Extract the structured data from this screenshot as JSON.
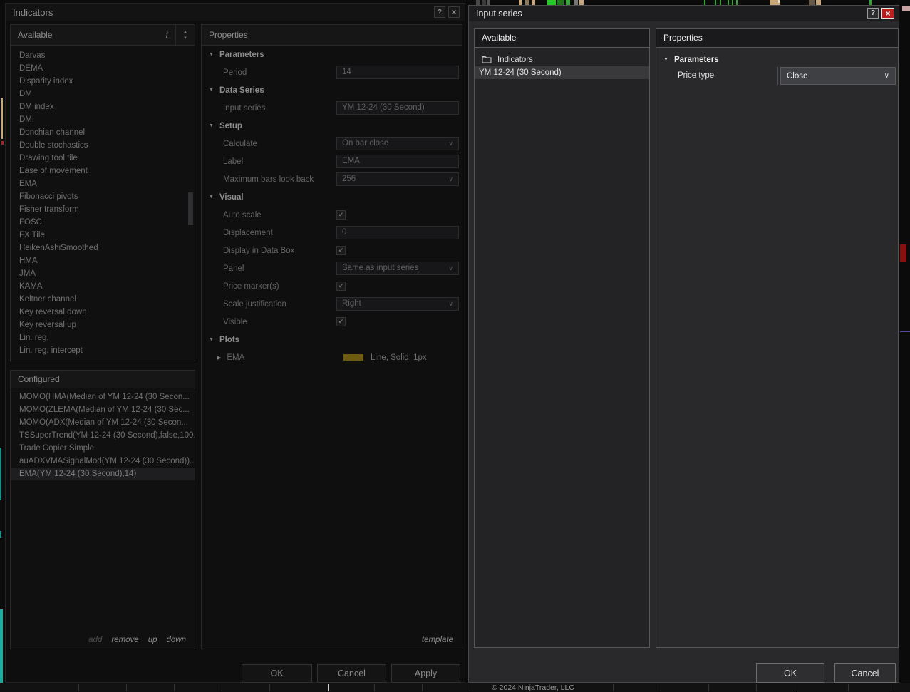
{
  "icons": {
    "help": "?",
    "close": "×",
    "info": "i",
    "check": "✔",
    "chevron_down": "∨",
    "collapse": "▼",
    "expand": "▶",
    "spinner_up": "▲",
    "spinner_down": "▼"
  },
  "colors": {
    "plot_swatch": "#6e5a12",
    "close_button_red": "#bf1b1b",
    "teal_accent": "#17b0a0",
    "selected_row": "#39393c"
  },
  "left_dialog": {
    "title": "Indicators",
    "available": {
      "header": "Available",
      "items": [
        "Darvas",
        "DEMA",
        "Disparity index",
        "DM",
        "DM index",
        "DMI",
        "Donchian channel",
        "Double stochastics",
        "Drawing tool tile",
        "Ease of movement",
        "EMA",
        "Fibonacci pivots",
        "Fisher transform",
        "FOSC",
        "FX Tile",
        "HeikenAshiSmoothed",
        "HMA",
        "JMA",
        "KAMA",
        "Keltner channel",
        "Key reversal down",
        "Key reversal up",
        "Lin. reg.",
        "Lin. reg. intercept"
      ]
    },
    "configured": {
      "header": "Configured",
      "items": [
        "MOMO(HMA(Median of YM 12-24 (30 Secon...",
        "MOMO(ZLEMA(Median of YM 12-24 (30 Sec...",
        "MOMO(ADX(Median of YM 12-24 (30 Secon...",
        "TSSuperTrend(YM 12-24 (30 Second),false,100...",
        "Trade Copier Simple",
        "auADXVMASignalMod(YM 12-24 (30 Second))...",
        "EMA(YM 12-24 (30 Second),14)"
      ],
      "selected_index": 6
    },
    "list_actions": {
      "add": "add",
      "remove": "remove",
      "up": "up",
      "down": "down"
    },
    "properties": {
      "header": "Properties",
      "template_link": "template",
      "groups": [
        {
          "label": "Parameters",
          "rows": [
            {
              "label": "Period",
              "type": "input",
              "value": "14"
            }
          ]
        },
        {
          "label": "Data Series",
          "rows": [
            {
              "label": "Input series",
              "type": "input",
              "value": "YM 12-24 (30 Second)"
            }
          ]
        },
        {
          "label": "Setup",
          "rows": [
            {
              "label": "Calculate",
              "type": "select",
              "value": "On bar close"
            },
            {
              "label": "Label",
              "type": "input",
              "value": "EMA"
            },
            {
              "label": "Maximum bars look back",
              "type": "select",
              "value": "256"
            }
          ]
        },
        {
          "label": "Visual",
          "rows": [
            {
              "label": "Auto scale",
              "type": "checkbox",
              "value": true
            },
            {
              "label": "Displacement",
              "type": "input",
              "value": "0"
            },
            {
              "label": "Display in Data Box",
              "type": "checkbox",
              "value": true
            },
            {
              "label": "Panel",
              "type": "select",
              "value": "Same as input series"
            },
            {
              "label": "Price marker(s)",
              "type": "checkbox",
              "value": true
            },
            {
              "label": "Scale justification",
              "type": "select",
              "value": "Right"
            },
            {
              "label": "Visible",
              "type": "checkbox",
              "value": true
            }
          ]
        },
        {
          "label": "Plots",
          "rows": [
            {
              "label": "EMA",
              "type": "plot",
              "value": "Line, Solid, 1px",
              "swatch": "#6e5a12"
            }
          ]
        }
      ]
    },
    "buttons": {
      "ok": "OK",
      "cancel": "Cancel",
      "apply": "Apply"
    }
  },
  "right_dialog": {
    "title": "Input series",
    "available": {
      "header": "Available",
      "folder_label": "Indicators",
      "items": [
        "YM 12-24 (30 Second)"
      ],
      "selected_index": 0
    },
    "properties": {
      "header": "Properties",
      "group_label": "Parameters",
      "price_type": {
        "label": "Price type",
        "value": "Close"
      }
    },
    "buttons": {
      "ok": "OK",
      "cancel": "Cancel"
    }
  },
  "status_bar": {
    "copyright": "© 2024 NinjaTrader, LLC"
  }
}
